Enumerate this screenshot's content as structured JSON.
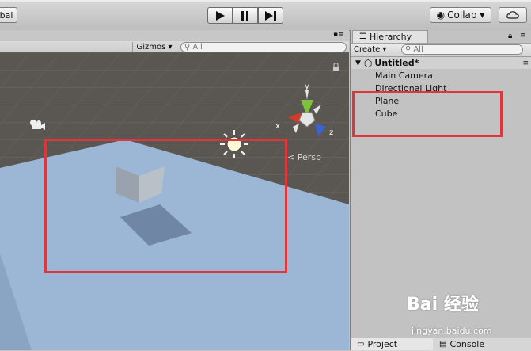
{
  "toolbar": {
    "pivot_label": "bal",
    "play_icon": "play-icon",
    "pause_icon": "pause-icon",
    "step_icon": "step-icon",
    "collab_label": "Collab ▾",
    "cloud_icon": "cloud-icon"
  },
  "scene": {
    "gizmos_label": "Gizmos ▾",
    "search_placeholder": "All",
    "persp_label": "< Persp",
    "axis_labels": {
      "x": "x",
      "y": "y",
      "z": "z"
    }
  },
  "hierarchy": {
    "tab_label": "Hierarchy",
    "create_label": "Create ▾",
    "search_placeholder": "All",
    "scene_name": "Untitled*",
    "items": [
      {
        "label": "Main Camera"
      },
      {
        "label": "Directional Light"
      },
      {
        "label": "Plane"
      },
      {
        "label": "Cube"
      }
    ]
  },
  "bottom_tabs": {
    "project": "Project",
    "console": "Console"
  },
  "watermark": {
    "text": "Bai 经验",
    "url": "jingyan.baidu.com"
  },
  "colors": {
    "annotation_red": "#e0353a",
    "plane_blue": "#9cb6d6",
    "scene_ground": "#5a5753"
  }
}
